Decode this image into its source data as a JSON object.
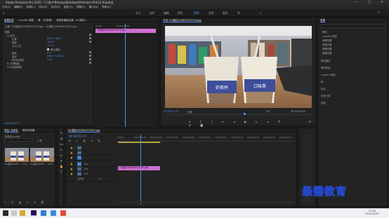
{
  "window": {
    "title": "Adobe Premiere Pro 2020 - C:\\用户\\ffdxq\\文档\\Adobe\\Premiere Pro\\14.0\\未命名",
    "controls": [
      "—",
      "□",
      "✕"
    ]
  },
  "menu": [
    "文件(F)",
    "编辑(E)",
    "剪辑(C)",
    "序列(S)",
    "标记(M)",
    "图形(G)",
    "视图(V)",
    "窗口(W)",
    "帮助(H)"
  ],
  "workspaces": [
    "学习",
    "组件",
    "编辑",
    "颜色",
    "效果",
    "音频",
    "图形",
    "库"
  ],
  "active_workspace": "效果",
  "effect_controls": {
    "tabs": [
      "效果控件",
      "Lumetri 范围",
      "源：(无剪辑)",
      "音频剪辑混合器：00(图片)"
    ],
    "active_tab": "效果控件",
    "source_label": "主要 * 00(图片)00820072020.jpg",
    "seq_label": "00(图片)00820072020.jpg",
    "timecode_start": "00:00",
    "timecode_mid": "00:00:05:00",
    "clip_name": "00(图片)00820072020.jpg",
    "sections": [
      {
        "label": "视频",
        "indent": 0
      },
      {
        "label": "fx 运动",
        "indent": 1
      },
      {
        "label": "位置",
        "indent": 2,
        "value": "640.0  360.0"
      },
      {
        "label": "缩放",
        "indent": 2,
        "value": "100.0"
      },
      {
        "label": "缩放宽度",
        "indent": 2,
        "value": "100.0"
      },
      {
        "label": "",
        "indent": 2,
        "checkbox": "等比缩放"
      },
      {
        "label": "旋转",
        "indent": 2,
        "value": "0.0"
      },
      {
        "label": "锚点",
        "indent": 2,
        "value": "2000.0  1500.0"
      },
      {
        "label": "防闪烁滤镜",
        "indent": 2,
        "value": "0.00"
      },
      {
        "label": "fx 不透明度",
        "indent": 1
      },
      {
        "label": "fx 时间重映射",
        "indent": 1
      }
    ],
    "footer_time": "00:00:01:07"
  },
  "program_monitor": {
    "title": "节目: 00(图片)00820072020.jpg",
    "timecode": "00:00:01:07",
    "fit": "适合",
    "quality": "1/2",
    "duration": "00:00:03:00"
  },
  "project": {
    "tabs": [
      "项目: 未命名",
      "媒体浏览器"
    ],
    "file_label": "未命名.prproj",
    "item_count": "2 项",
    "thumbs": [
      {
        "name": "00(图片)0082...",
        "dur": "5:00"
      },
      {
        "name": "00(图片)0082...",
        "dur": "5:00"
      }
    ]
  },
  "timeline": {
    "title": "00(图片)00820072020.jpg",
    "timecode": "00:00:01:07",
    "ruler": [
      "00:00",
      "00:00:05:00",
      "00:00:10:00",
      "00:00:15:00",
      "00:00:20:00",
      "00:00:25:00",
      "00:00:30:00",
      "00:00:35:00",
      "00:00:40:00",
      "00:00:45:00",
      "00:00:50:00"
    ],
    "tracks": [
      "V3",
      "V2",
      "V1",
      "A1",
      "A2",
      "A3",
      "主声道"
    ],
    "master_value": "0.0",
    "clip": "00(图片)00820072020.jpg"
  },
  "effects_panel": {
    "title": "效果",
    "tree": [
      "预设",
      "Lumetri 预设",
      "音频效果",
      "音频过渡",
      "视频效果",
      "视频过渡"
    ],
    "sections": [
      "基本图形",
      "基本声音",
      "Lumetri 颜色",
      "库",
      "标记",
      "历史记录",
      "信息"
    ]
  },
  "watermark": "最需教育",
  "taskbar": {
    "time": "17:26",
    "date": "2021/10/26"
  },
  "colors": {
    "accent": "#4d8ff0",
    "clip": "#d06fd2",
    "playhead": "#4d8ff0"
  }
}
